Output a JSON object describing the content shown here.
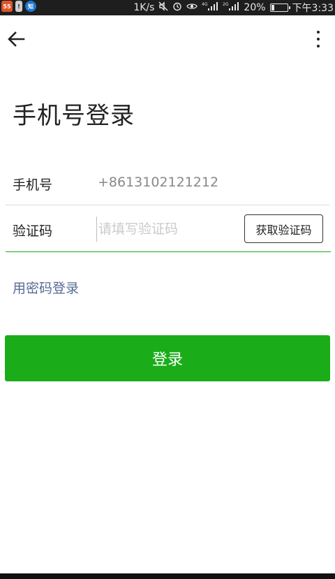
{
  "status_bar": {
    "app_icons": [
      "55",
      "!",
      "知"
    ],
    "net_speed": "1K/s",
    "icons": [
      "mute-icon",
      "alarm-icon",
      "eye-icon",
      "signal-4g-icon",
      "signal-2g-icon"
    ],
    "net_4g": "4G",
    "net_2g": "2G",
    "battery": "20%",
    "battery_level": 0.2,
    "time": "下午3:33"
  },
  "header": {
    "back_icon": "back-arrow-icon",
    "more_icon": "more-vert-icon"
  },
  "title": "手机号登录",
  "form": {
    "phone_label": "手机号",
    "phone_value": "+8613102121212",
    "code_label": "验证码",
    "code_placeholder": "请填写验证码",
    "get_code_label": "获取验证码"
  },
  "password_login_link": "用密码登录",
  "login_button": "登录",
  "colors": {
    "primary_green": "#1aad19",
    "link_blue": "#576b95",
    "status_bar": "#1e1e1e"
  }
}
